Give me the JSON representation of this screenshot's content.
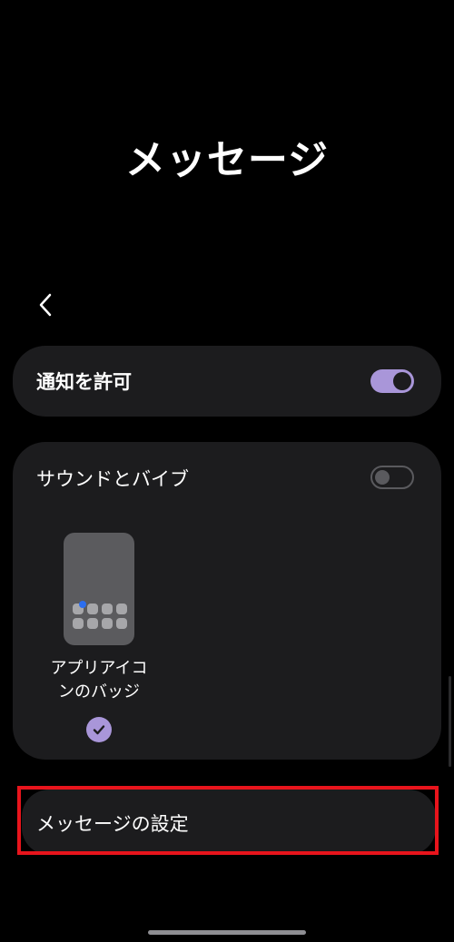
{
  "header": {
    "title": "メッセージ"
  },
  "allow_notifications": {
    "label": "通知を許可",
    "enabled": true
  },
  "sound_vibration": {
    "label": "サウンドとバイブ",
    "enabled": false
  },
  "badge_option": {
    "caption_line1": "アプリアイコ",
    "caption_line2": "ンのバッジ",
    "selected": true
  },
  "message_settings": {
    "label": "メッセージの設定"
  },
  "colors": {
    "accent": "#a996d9",
    "badge": "#2b6ef0",
    "highlight": "#e8141c",
    "card": "#1c1c1e",
    "background": "#000000"
  },
  "icons": {
    "back": "chevron-left-icon",
    "check": "check-icon"
  }
}
